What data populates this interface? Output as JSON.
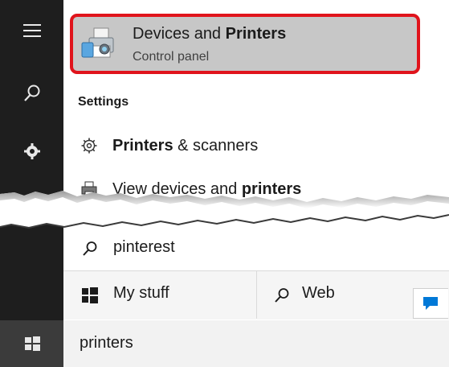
{
  "rail": {
    "icons": [
      "hamburger-menu-icon",
      "search-icon",
      "settings-gear-icon",
      "windows-start-icon"
    ]
  },
  "best_match": {
    "title_prefix": "Devices and ",
    "title_bold": "Printers",
    "subtitle": "Control panel",
    "icon": "devices-printers-icon",
    "highlight_color": "#e0141c"
  },
  "settings": {
    "heading": "Settings",
    "items": [
      {
        "bold": "Printers",
        "rest": " & scanners",
        "icon": "gear-icon"
      },
      {
        "prefix": "View devices and ",
        "bold": "printers",
        "icon": "printer-icon"
      }
    ]
  },
  "web_suggestion": {
    "text": "pinterest",
    "icon": "search-icon"
  },
  "scopes": [
    {
      "label": "My stuff",
      "icon": "windows-logo-icon"
    },
    {
      "label": "Web",
      "icon": "search-icon"
    }
  ],
  "feedback": {
    "icon": "feedback-icon"
  },
  "search_box": {
    "value": "printers"
  },
  "colors": {
    "rail": "#1e1e1e",
    "rail_start": "#3b3b3b",
    "selection": "#c7c7c7",
    "accent": "#0078d7"
  }
}
